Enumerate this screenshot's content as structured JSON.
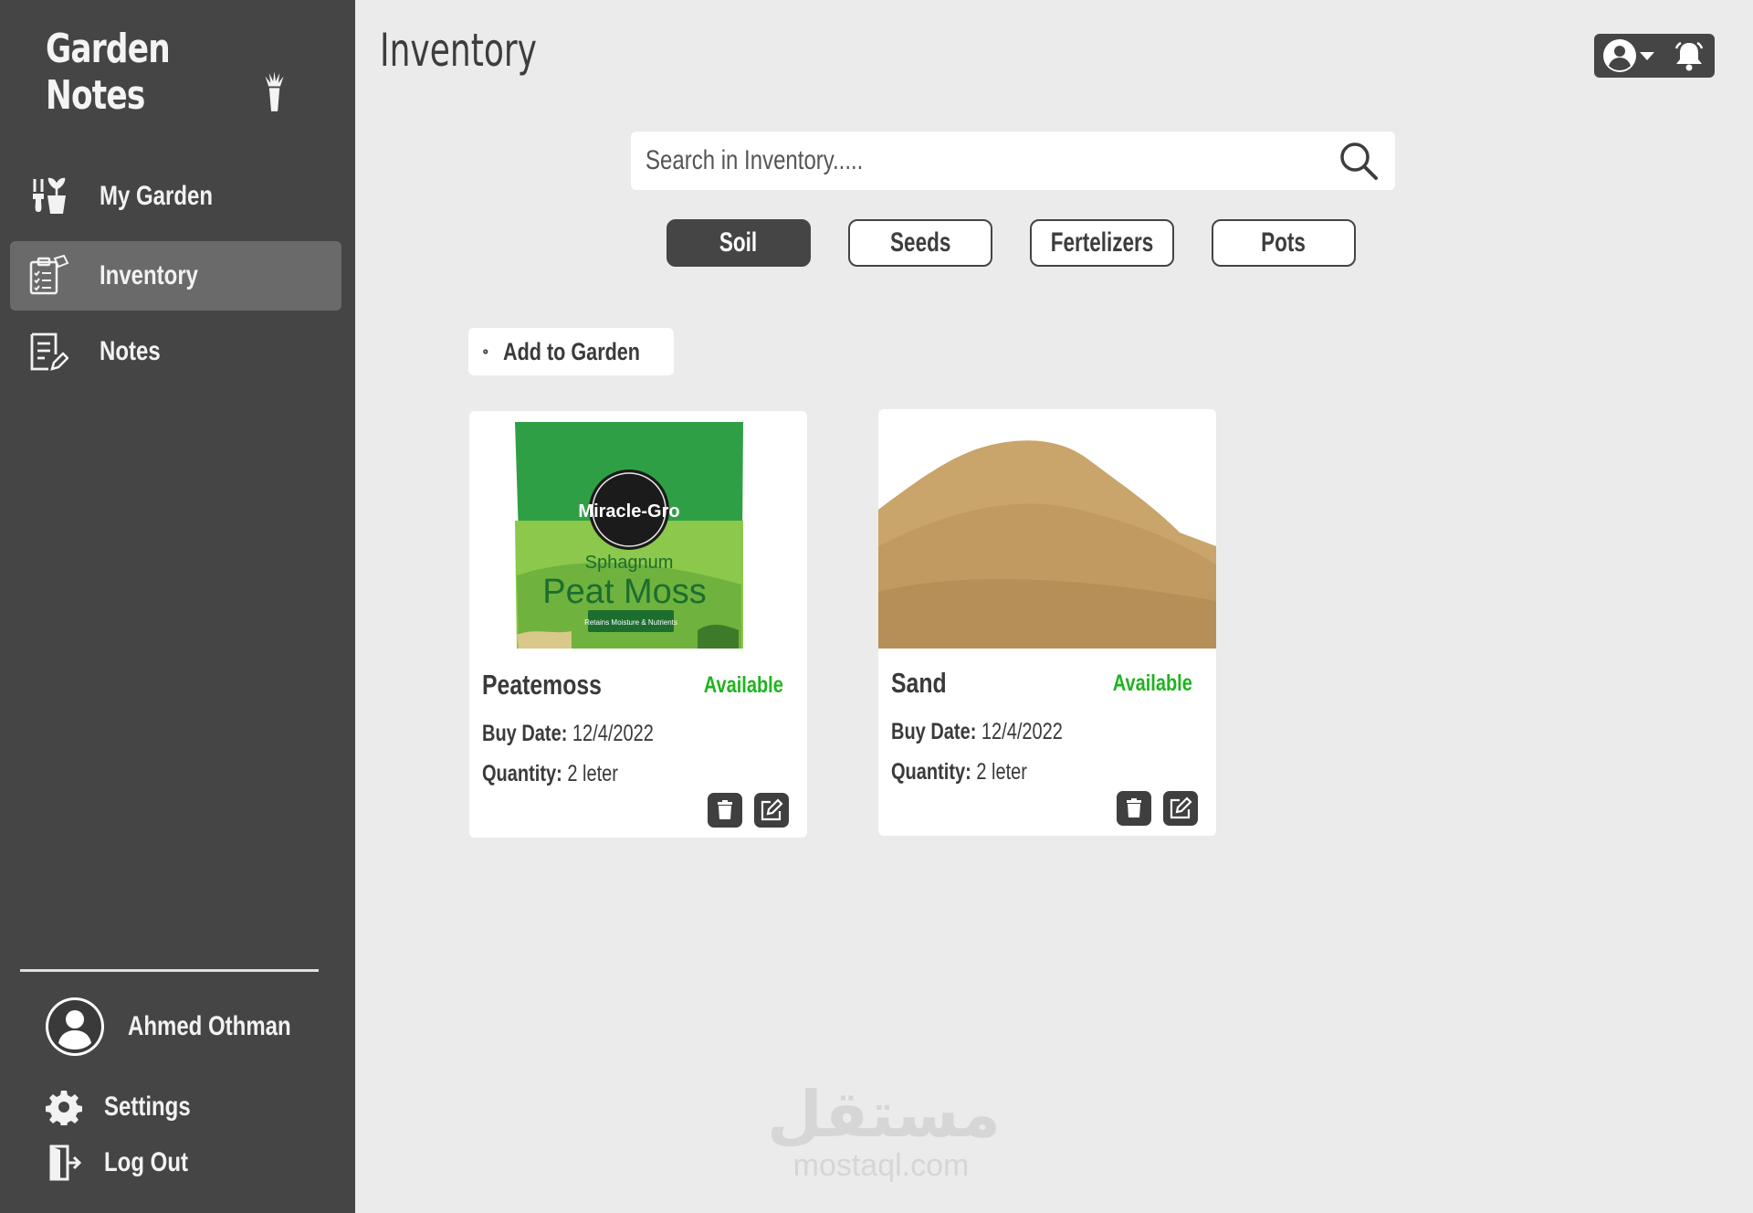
{
  "app": {
    "logo_text": "Garden Notes",
    "page_title": "Inventory"
  },
  "sidebar": {
    "items": [
      {
        "label": "My Garden",
        "icon": "plant-tools-icon",
        "active": false
      },
      {
        "label": "Inventory",
        "icon": "inventory-clipboard-icon",
        "active": true
      },
      {
        "label": "Notes",
        "icon": "notes-icon",
        "active": false
      }
    ],
    "user_name": "Ahmed Othman",
    "settings_label": "Settings",
    "logout_label": "Log Out"
  },
  "search": {
    "placeholder": "Search in Inventory.....",
    "value": ""
  },
  "filters": [
    {
      "label": "Soil",
      "active": true
    },
    {
      "label": "Seeds",
      "active": false
    },
    {
      "label": "Fertelizers",
      "active": false
    },
    {
      "label": "Pots",
      "active": false
    }
  ],
  "add_button_label": "Add to Garden",
  "cards": [
    {
      "title": "Peatemoss",
      "status": "Available",
      "buy_date_label": "Buy Date:",
      "buy_date": "12/4/2022",
      "quantity_label": "Quantity:",
      "quantity": "2 leter",
      "image": {
        "brand": "Miracle-Gro",
        "line1": "Sphagnum",
        "line2": "Peat Moss",
        "tag": "Retains Moisture & Nutrients"
      }
    },
    {
      "title": "Sand",
      "status": "Available",
      "buy_date_label": "Buy Date:",
      "buy_date": "12/4/2022",
      "quantity_label": "Quantity:",
      "quantity": "2 leter"
    }
  ],
  "watermark": {
    "arabic": "مستقل",
    "latin": "mostaql.com"
  },
  "colors": {
    "sidebar": "#454545",
    "background": "#ebebeb",
    "active_nav": "#6a6a6a",
    "status_green": "#1fb31f"
  }
}
